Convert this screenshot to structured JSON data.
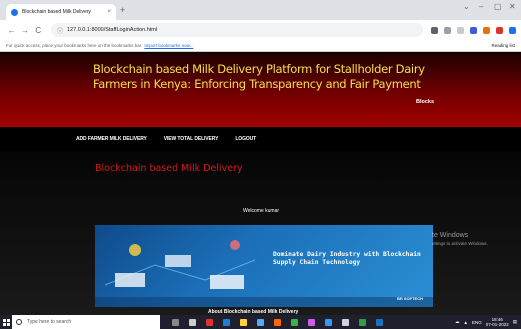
{
  "browser": {
    "tab_title": "Blockchain based Milk Delivery",
    "tab_close": "×",
    "new_tab": "+",
    "url": "127.0.0.1:8000/StaffLoginAction.html",
    "bookmarks_prompt": "For quick access, place your bookmarks here on the bookmarks bar.",
    "bookmarks_link": "Import bookmarks now...",
    "reading_list": "Reading list",
    "window_controls": {
      "minimize": "–",
      "restore": "▢",
      "close": "✕",
      "collapse": "⌄"
    },
    "nav": {
      "back": "←",
      "forward": "→",
      "reload": "C"
    }
  },
  "site": {
    "title": "Blockchain based Milk Delivery Platform for Stallholder Dairy Farmers in Kenya: Enforcing Transparency and Fair Payment",
    "header_link": "Blocks"
  },
  "nav": {
    "items": [
      {
        "label": "ADD FARMER MILK DELIVERY"
      },
      {
        "label": "VIEW TOTAL DELIVERY"
      },
      {
        "label": "LOGOUT"
      }
    ]
  },
  "main": {
    "section_title": "Blockchain based Milk Delivery",
    "welcome": "Welcome kumar",
    "banner_text": "Dominate Dairy Industry with Blockchain Supply Chain Technology",
    "banner_logo": "BR SOFTECH",
    "about_heading": "About Blockchain based Milk Delivery"
  },
  "watermark": {
    "line1": "te Windows",
    "line2": "ettings to activate Windows."
  },
  "taskbar": {
    "search_placeholder": "Type here to search",
    "time": "18:46",
    "date": "07-01-2022",
    "lang": "ENG"
  },
  "colors": {
    "title_yellow": "#f3e04a",
    "section_red": "#d11a1a",
    "header_red": "#a30000"
  }
}
